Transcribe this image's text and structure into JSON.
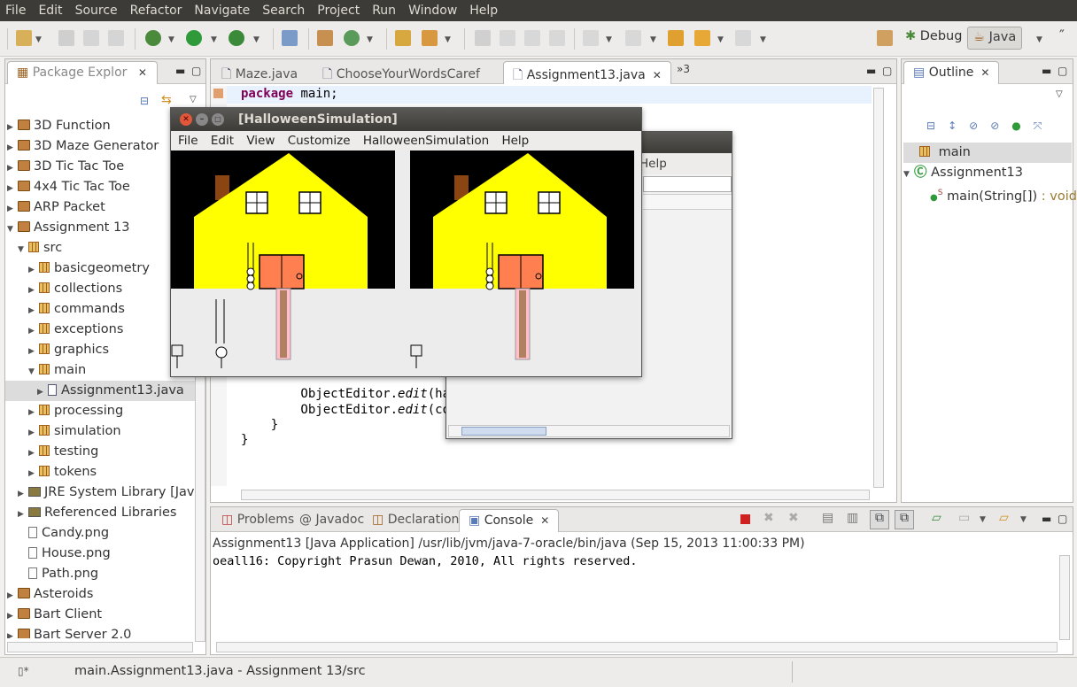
{
  "menubar": {
    "items": [
      "File",
      "Edit",
      "Source",
      "Refactor",
      "Navigate",
      "Search",
      "Project",
      "Run",
      "Window",
      "Help"
    ]
  },
  "perspectives": {
    "debug": "Debug",
    "java": "Java"
  },
  "package_explorer": {
    "tab_label": "Package Explor",
    "items": [
      {
        "label": "3D Function",
        "kind": "project",
        "expanded": false
      },
      {
        "label": "3D Maze Generator",
        "kind": "project",
        "expanded": false
      },
      {
        "label": "3D Tic Tac Toe",
        "kind": "project",
        "expanded": false
      },
      {
        "label": "4x4 Tic Tac Toe",
        "kind": "project",
        "expanded": false
      },
      {
        "label": "ARP Packet",
        "kind": "project",
        "expanded": false
      },
      {
        "label": "Assignment 13",
        "kind": "project",
        "expanded": true
      },
      {
        "label": "src",
        "kind": "source-folder",
        "expanded": true
      },
      {
        "label": "basicgeometry",
        "kind": "package"
      },
      {
        "label": "collections",
        "kind": "package"
      },
      {
        "label": "commands",
        "kind": "package"
      },
      {
        "label": "exceptions",
        "kind": "package"
      },
      {
        "label": "graphics",
        "kind": "package"
      },
      {
        "label": "main",
        "kind": "package",
        "expanded": true
      },
      {
        "label": "Assignment13.java",
        "kind": "java-file",
        "selected": true
      },
      {
        "label": "processing",
        "kind": "package"
      },
      {
        "label": "simulation",
        "kind": "package"
      },
      {
        "label": "testing",
        "kind": "package"
      },
      {
        "label": "tokens",
        "kind": "package"
      },
      {
        "label": "JRE System Library [Java",
        "kind": "library"
      },
      {
        "label": "Referenced Libraries",
        "kind": "library"
      },
      {
        "label": "Candy.png",
        "kind": "file"
      },
      {
        "label": "House.png",
        "kind": "file"
      },
      {
        "label": "Path.png",
        "kind": "file"
      },
      {
        "label": "Asteroids",
        "kind": "project"
      },
      {
        "label": "Bart Client",
        "kind": "project"
      },
      {
        "label": "Bart Server 2.0",
        "kind": "project"
      }
    ]
  },
  "editor": {
    "tabs": [
      {
        "label": "Maze.java"
      },
      {
        "label": "ChooseYourWordsCaref"
      },
      {
        "label": "Assignment13.java",
        "active": true
      }
    ],
    "overflow": "»3",
    "code_line_1_kw": "package",
    "code_line_1_rest": " main;",
    "line_a_prefix": "        ObjectEditor.",
    "line_a_method": "edit",
    "line_a_rest": "(hal",
    "line_b_prefix": "        ObjectEditor.",
    "line_b_method": "edit",
    "line_b_rest": "(com",
    "close_brace_1": "    }",
    "close_brace_2": "}"
  },
  "outline": {
    "tab_label": "Outline",
    "package": "main",
    "class": "Assignment13",
    "method": "main(String[])",
    "method_type": " : void"
  },
  "halloween_window": {
    "title": "[HalloweenSimulation]",
    "menu": [
      "File",
      "Edit",
      "View",
      "Customize",
      "HalloweenSimulation",
      "Help"
    ]
  },
  "background_window": {
    "menu_fragment": "Help"
  },
  "bottom_panel": {
    "tabs": [
      {
        "label": "Problems"
      },
      {
        "label": "Javadoc"
      },
      {
        "label": "Declaration"
      },
      {
        "label": "Console",
        "active": true
      }
    ],
    "console_header": "Assignment13 [Java Application] /usr/lib/jvm/java-7-oracle/bin/java (Sep 15, 2013 11:00:33 PM)",
    "console_output": "oeall16: Copyright Prasun Dewan, 2010, All rights reserved."
  },
  "statusbar": {
    "text": "main.Assignment13.java - Assignment 13/src"
  },
  "colors": {
    "house": "#ffff00",
    "door": "#ff7f50",
    "sky": "#000000",
    "chimney": "#8b4513",
    "path_pink": "#ffc0cb"
  }
}
